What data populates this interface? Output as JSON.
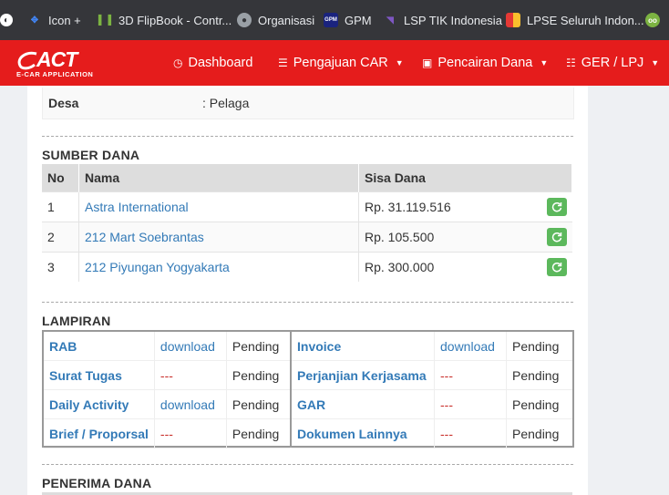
{
  "bookmarks": [
    {
      "label": "Icon +",
      "icon": "arrows-icon",
      "color": "#4285f4"
    },
    {
      "label": "3D FlipBook - Contr...",
      "icon": "book-icon",
      "color": "#7cb342"
    },
    {
      "label": "Organisasi",
      "icon": "globe-icon",
      "color": "#9aa0a6"
    },
    {
      "label": "GPM",
      "icon": "gpm-icon",
      "color": "#1a237e"
    },
    {
      "label": "LSP TIK Indonesia",
      "icon": "lsp-icon",
      "color": "#5e35b1"
    },
    {
      "label": "LPSE Seluruh Indon...",
      "icon": "lpse-icon",
      "color": "#e53935"
    }
  ],
  "navbar": {
    "brand": "ACT",
    "brand_sub": "E-CAR APPLICATION",
    "items": [
      {
        "label": "Dashboard",
        "icon": "dashboard-icon",
        "dropdown": false
      },
      {
        "label": "Pengajuan CAR",
        "icon": "list-icon",
        "dropdown": true
      },
      {
        "label": "Pencairan Dana",
        "icon": "money-icon",
        "dropdown": true
      },
      {
        "label": "GER / LPJ",
        "icon": "tasks-icon",
        "dropdown": true
      }
    ],
    "color": "#e51c1c"
  },
  "desa": {
    "label": "Desa",
    "value": ": Pelaga"
  },
  "sumber_dana": {
    "title": "SUMBER DANA",
    "headers": [
      "No",
      "Nama",
      "Sisa Dana"
    ],
    "rows": [
      {
        "no": "1",
        "nama": "Astra International",
        "sisa": "Rp. 31.119.516"
      },
      {
        "no": "2",
        "nama": "212 Mart Soebrantas",
        "sisa": "Rp. 105.500"
      },
      {
        "no": "3",
        "nama": "212 Piyungan Yogyakarta",
        "sisa": "Rp. 300.000"
      }
    ]
  },
  "lampiran": {
    "title": "LAMPIRAN",
    "left": [
      {
        "label": "RAB",
        "file": "download",
        "status": "Pending"
      },
      {
        "label": "Surat Tugas",
        "file": "---",
        "status": "Pending"
      },
      {
        "label": "Daily Activity",
        "file": "download",
        "status": "Pending"
      },
      {
        "label": "Brief / Proporsal",
        "file": "---",
        "status": "Pending"
      }
    ],
    "right": [
      {
        "label": "Invoice",
        "file": "download",
        "status": "Pending"
      },
      {
        "label": "Perjanjian Kerjasama",
        "file": "---",
        "status": "Pending"
      },
      {
        "label": "GAR",
        "file": "---",
        "status": "Pending"
      },
      {
        "label": "Dokumen Lainnya",
        "file": "---",
        "status": "Pending"
      }
    ]
  },
  "penerima_dana": {
    "title": "PENERIMA DANA"
  },
  "colors": {
    "accent": "#e51c1c",
    "link": "#337ab7",
    "success": "#5cb85c",
    "missing": "#c9302c"
  }
}
